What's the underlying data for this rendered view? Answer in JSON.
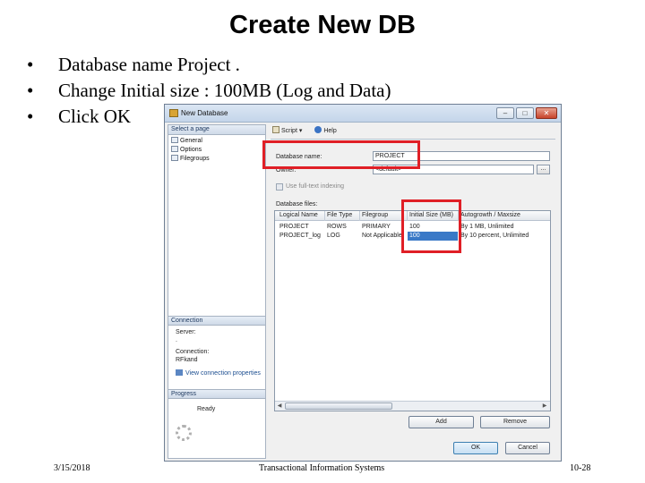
{
  "slide": {
    "title": "Create New DB",
    "bullets": [
      "Database name Project .",
      "Change Initial size : 100MB  (Log and  Data)",
      "Click OK"
    ],
    "bullet_glyph": "•",
    "footer": {
      "date": "3/15/2018",
      "center": "Transactional Information Systems",
      "page": "10-28"
    }
  },
  "dialog": {
    "title": "New Database",
    "window_buttons": [
      "–",
      "□",
      "✕"
    ],
    "select_page_header": "Select a page",
    "pages": [
      "General",
      "Options",
      "Filegroups"
    ],
    "connection": {
      "header": "Connection",
      "server_label": "Server:",
      "server_value": ".",
      "connection_label": "Connection:",
      "connection_value": "RFkand",
      "view_link": "View connection properties"
    },
    "progress": {
      "header": "Progress",
      "status": "Ready"
    },
    "toolbar": {
      "script": "Script",
      "help": "Help"
    },
    "fields": {
      "database_name_label": "Database name:",
      "database_name_value": "PROJECT",
      "owner_label": "Owner:",
      "owner_value": "<default>",
      "browse_label": "...",
      "fulltext_label": "Use full-text indexing"
    },
    "files": {
      "label": "Database files:",
      "columns": [
        "Logical Name",
        "File Type",
        "Filegroup",
        "Initial Size (MB)",
        "Autogrowth / Maxsize"
      ],
      "rows": [
        [
          "PROJECT",
          "ROWS",
          "PRIMARY",
          "100",
          "By 1 MB, Unlimited"
        ],
        [
          "PROJECT_log",
          "LOG",
          "Not Applicable",
          "100",
          "By 10 percent, Unlimited"
        ]
      ]
    },
    "buttons": {
      "add": "Add",
      "remove": "Remove",
      "ok": "OK",
      "cancel": "Cancel"
    }
  },
  "colors": {
    "highlight": "#e01f26",
    "selection": "#3a79c7"
  }
}
